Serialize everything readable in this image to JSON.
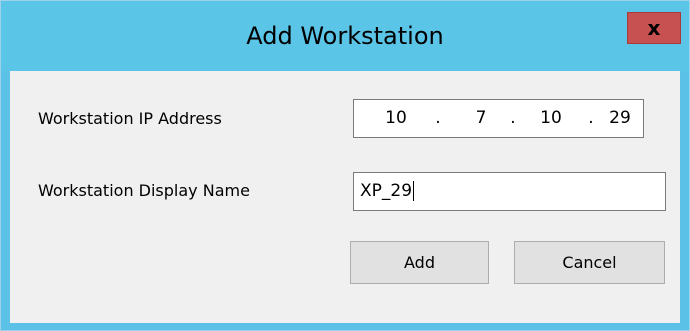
{
  "window": {
    "title": "Add Workstation",
    "close_glyph": "x"
  },
  "form": {
    "ip_label": "Workstation IP Address",
    "ip_octets": [
      "10",
      "7",
      "10",
      "29"
    ],
    "ip_separator": ".",
    "name_label": "Workstation Display Name",
    "name_value": "XP_29"
  },
  "buttons": {
    "add_label": "Add",
    "cancel_label": "Cancel"
  },
  "colors": {
    "titlebar": "#5bc5e8",
    "close_button": "#c75050",
    "client_background": "#f0f0f0"
  },
  "icons": {
    "close": "close-icon"
  }
}
